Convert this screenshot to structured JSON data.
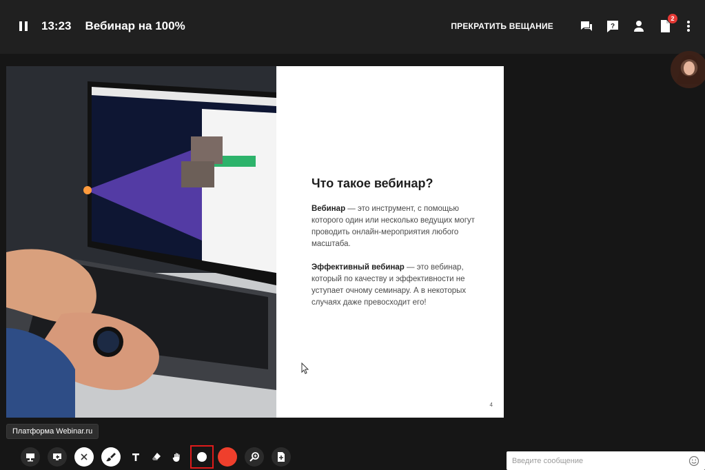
{
  "header": {
    "timer": "13:23",
    "title": "Вебинар на 100%",
    "stop_broadcast": "ПРЕКРАТИТЬ ВЕЩАНИЕ",
    "icons": [
      "chat-icon",
      "question-icon",
      "participants-icon",
      "files-icon",
      "more-icon"
    ],
    "files_badge": "2"
  },
  "slide": {
    "heading": "Что такое вебинар?",
    "para1_bold": "Вебинар",
    "para1_rest": " — это инструмент, с помощью которого один или несколько ведущих могут проводить онлайн-мероприятия любого масштаба.",
    "para2_bold": "Эффективный вебинар",
    "para2_rest": " — это вебинар, который по качеству и эффективности не уступает очному семинару. А в некоторых случаях даже превосходит его!",
    "page_number": "4"
  },
  "platform_label": "Платформа Webinar.ru",
  "toolbar": {
    "tools": [
      "presentation-icon",
      "screen-share-icon",
      "close-icon",
      "brush-icon",
      "text-icon",
      "eraser-icon",
      "hand-icon",
      "size-dot-icon",
      "color-red-icon",
      "zoom-icon",
      "add-file-icon"
    ]
  },
  "chat": {
    "placeholder": "Введите сообщение"
  },
  "colors": {
    "accent_red": "#ef3f2c",
    "selection_border": "#e01b1b",
    "badge": "#e53935",
    "topbar": "#202020",
    "background": "#161616"
  }
}
